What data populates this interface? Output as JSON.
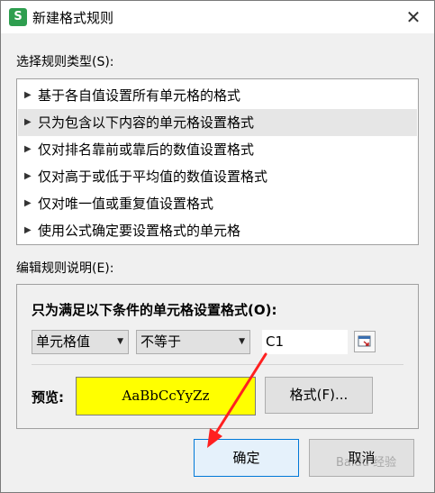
{
  "dialog": {
    "title": "新建格式规则",
    "app_icon_glyph": "S",
    "close_glyph": "✕"
  },
  "rule_type": {
    "label": "选择规则类型(S):",
    "items": [
      {
        "label": "基于各自值设置所有单元格的格式"
      },
      {
        "label": "只为包含以下内容的单元格设置格式",
        "selected": true
      },
      {
        "label": "仅对排名靠前或靠后的数值设置格式"
      },
      {
        "label": "仅对高于或低于平均值的数值设置格式"
      },
      {
        "label": "仅对唯一值或重复值设置格式"
      },
      {
        "label": "使用公式确定要设置格式的单元格"
      }
    ]
  },
  "edit_rule": {
    "label": "编辑规则说明(E):",
    "condition_title": "只为满足以下条件的单元格设置格式(O):",
    "condition_type": "单元格值",
    "operator": "不等于",
    "value": "C1",
    "preview_label": "预览:",
    "preview_text": "AaBbCcYyZz",
    "preview_bg": "#ffff00",
    "format_button": "格式(F)..."
  },
  "buttons": {
    "ok": "确定",
    "cancel": "取消"
  },
  "annotation": {
    "arrow_color": "#ff2020"
  },
  "watermark": {
    "text": "Baidu 经验"
  }
}
